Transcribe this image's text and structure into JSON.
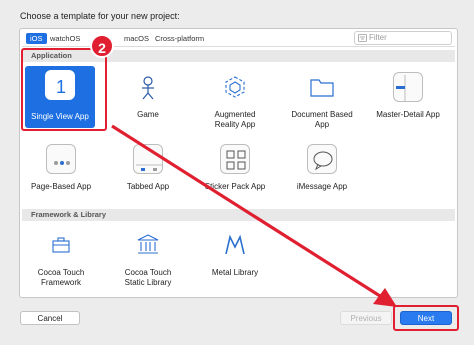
{
  "dialog": {
    "title": "Choose a template for your new project:"
  },
  "platform_tabs": [
    "iOS",
    "watchOS",
    "macOS",
    "Cross-platform"
  ],
  "filter": {
    "placeholder": "Filter"
  },
  "sections": {
    "application": "Application",
    "framework": "Framework & Library"
  },
  "templates": {
    "single_view": {
      "label": "Single View App",
      "icon": "number-one-icon"
    },
    "game": {
      "label": "Game",
      "icon": "game-character-icon"
    },
    "ar": {
      "label": "Augmented\nReality App",
      "icon": "ar-cube-icon"
    },
    "document": {
      "label": "Document Based\nApp",
      "icon": "folder-icon"
    },
    "master_detail": {
      "label": "Master-Detail App",
      "icon": "split-view-icon"
    },
    "page_based": {
      "label": "Page-Based App",
      "icon": "page-dots-icon"
    },
    "tabbed": {
      "label": "Tabbed App",
      "icon": "tab-bar-icon"
    },
    "sticker": {
      "label": "Sticker Pack App",
      "icon": "grid-icon"
    },
    "imessage": {
      "label": "iMessage App",
      "icon": "speech-bubble-icon"
    },
    "cocoa_touch_framework": {
      "label": "Cocoa Touch\nFramework",
      "icon": "toolbox-icon"
    },
    "cocoa_touch_static": {
      "label": "Cocoa Touch\nStatic Library",
      "icon": "building-icon"
    },
    "metal_library": {
      "label": "Metal Library",
      "icon": "metal-icon"
    }
  },
  "annotation": {
    "step": "2"
  },
  "buttons": {
    "cancel": "Cancel",
    "previous": "Previous",
    "next": "Next"
  },
  "colors": {
    "accent": "#1d6fe2",
    "annotation_red": "#e02030"
  }
}
